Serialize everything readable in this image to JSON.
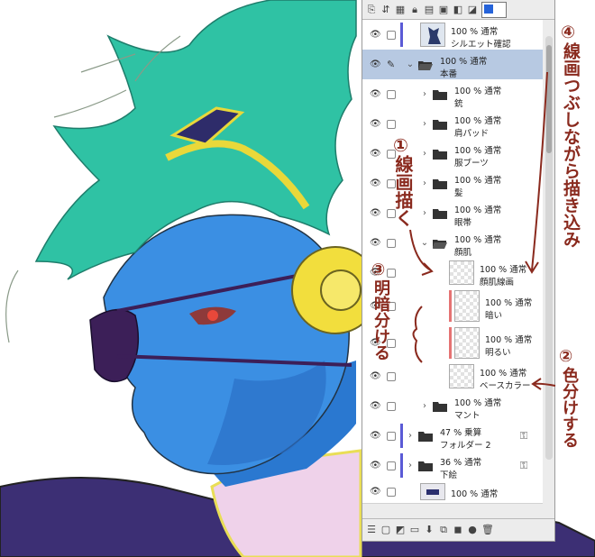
{
  "panel": {
    "top_toolbar_icons": [
      "layer-props-icon",
      "transfer-icon",
      "lock-all-icon",
      "lock-icon",
      "clip-icon",
      "ref-icon",
      "draft-icon",
      "mask-display-icon",
      "select-icon"
    ],
    "color_chip_color": "#2563d9",
    "layers": [
      {
        "kind": "layer",
        "indent": 0,
        "line1": "100 % 通常",
        "line2": "シルエット確認",
        "tag": "#5b5bd6",
        "thumb": "figure"
      },
      {
        "kind": "folder",
        "indent": 0,
        "open": true,
        "selected": true,
        "line1": "100 % 通常",
        "line2": "本番",
        "pen": true
      },
      {
        "kind": "folder",
        "indent": 1,
        "open": false,
        "line1": "100 % 通常",
        "line2": "銃"
      },
      {
        "kind": "folder",
        "indent": 1,
        "open": false,
        "line1": "100 % 通常",
        "line2": "肩パッド"
      },
      {
        "kind": "folder",
        "indent": 1,
        "open": false,
        "line1": "100 % 通常",
        "line2": "服ブーツ"
      },
      {
        "kind": "folder",
        "indent": 1,
        "open": false,
        "line1": "100 % 通常",
        "line2": "髪"
      },
      {
        "kind": "folder",
        "indent": 1,
        "open": false,
        "line1": "100 % 通常",
        "line2": "眼帯"
      },
      {
        "kind": "folder",
        "indent": 1,
        "open": true,
        "line1": "100 % 通常",
        "line2": "顔肌"
      },
      {
        "kind": "layer",
        "indent": 2,
        "line1": "100 % 通常",
        "line2": "顔肌線画"
      },
      {
        "kind": "layer",
        "indent": 2,
        "line1": "100 % 通常",
        "line2": "暗い",
        "red": true,
        "clip": true
      },
      {
        "kind": "layer",
        "indent": 2,
        "line1": "100 % 通常",
        "line2": "明るい",
        "red": true,
        "clip": true
      },
      {
        "kind": "layer",
        "indent": 2,
        "line1": "100 % 通常",
        "line2": "ベースカラー"
      },
      {
        "kind": "folder",
        "indent": 1,
        "open": false,
        "line1": "100 % 通常",
        "line2": "マント"
      },
      {
        "kind": "folder",
        "indent": 0,
        "open": false,
        "line1": "47 % 乗算",
        "line2": "フォルダー 2",
        "tag": "#5b5bd6",
        "mask": true
      },
      {
        "kind": "folder",
        "indent": 0,
        "open": false,
        "line1": "36 % 通常",
        "line2": "下絵",
        "tag": "#5b5bd6",
        "mask": true
      },
      {
        "kind": "layer",
        "indent": 0,
        "line1": "100 % 通常",
        "line2": "",
        "thumb": "dark"
      }
    ],
    "bottom_toolbar_icons": [
      "panel-menu-icon",
      "new-raster-icon",
      "new-vector-icon",
      "new-folder-icon",
      "transfer-down-icon",
      "combine-icon",
      "mask-add-icon",
      "mask-apply-icon",
      "delete-icon"
    ]
  },
  "annotations": {
    "note1_number": "①",
    "note1_text": "線画描く",
    "note2_number": "②",
    "note2_text": "色分けする",
    "note3_number": "③",
    "note3_text": "明暗分ける",
    "note4_number": "④",
    "note4_text": "線画つぶしながら描き込み"
  },
  "colors": {
    "skin": "#3a8fe0",
    "hair": "#2fc2a4",
    "headphone": "#f0dc3a",
    "eyepatch": "#3a1e55",
    "cape": "#3a2f6e",
    "note_ink": "#8a2a1e"
  }
}
